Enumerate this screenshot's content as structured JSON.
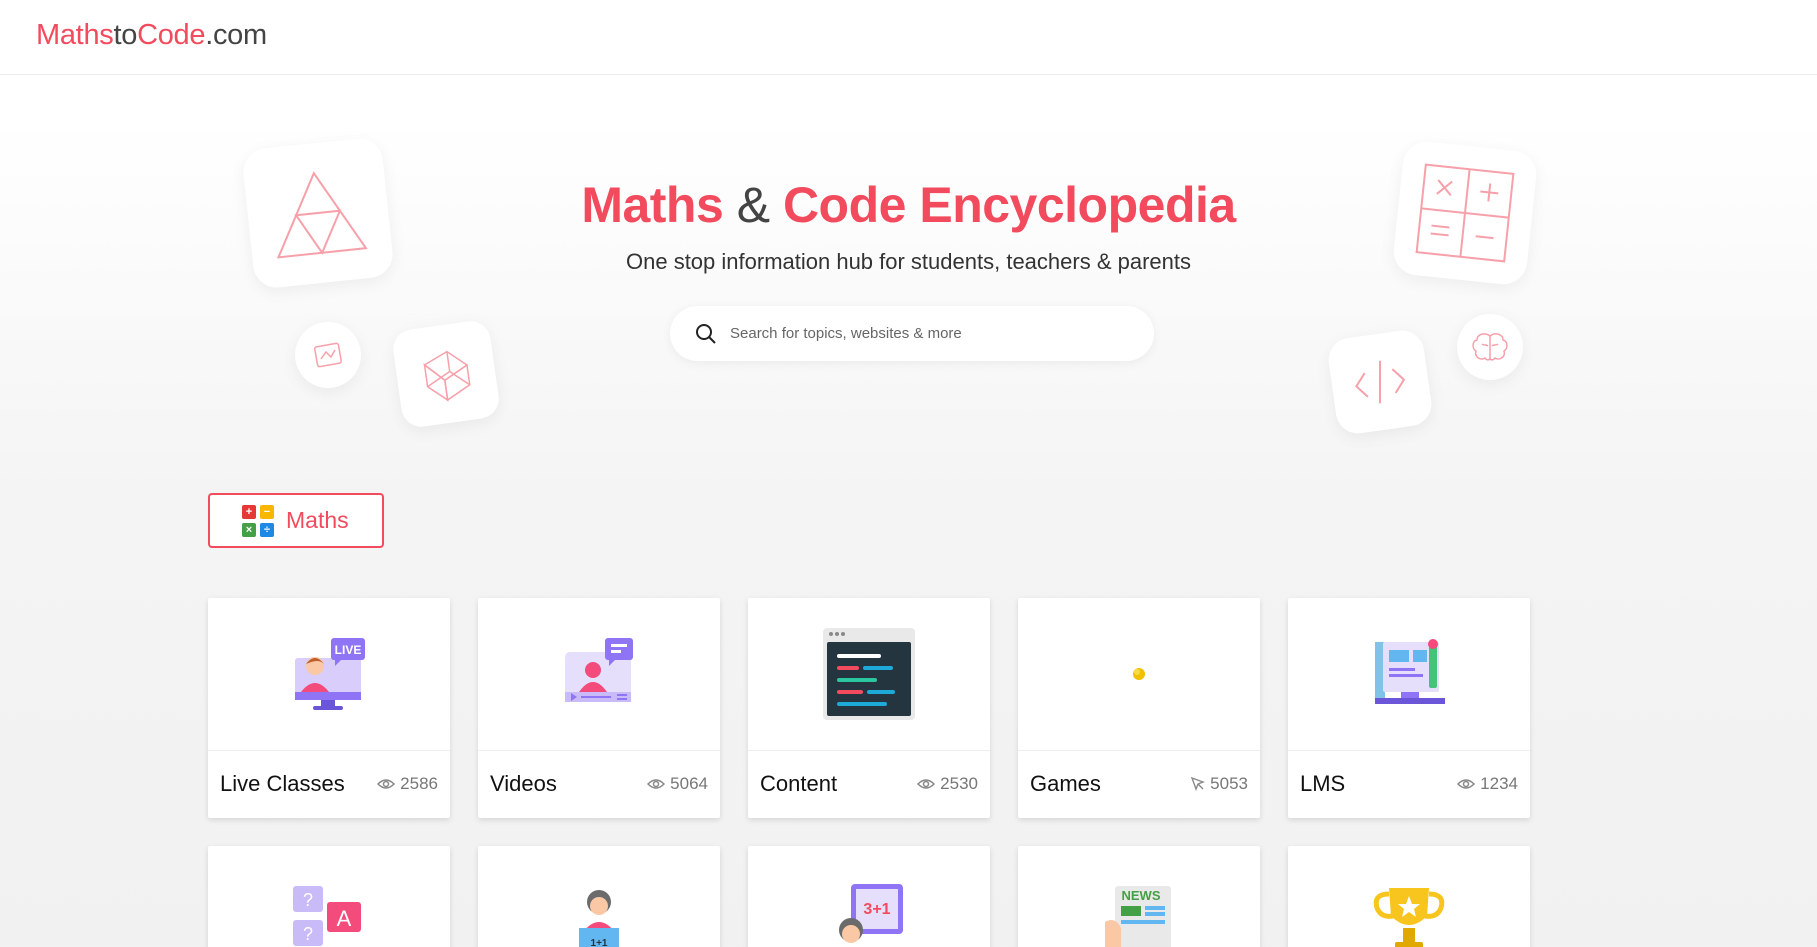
{
  "header": {
    "logo": {
      "part1": "Maths",
      "part2": "to",
      "part3": "Code",
      "part4": ".com"
    }
  },
  "hero": {
    "title_part1": "Maths",
    "title_amp": "&",
    "title_part2": "Code Encyclopedia",
    "subtitle": "One stop information hub for students, teachers & parents",
    "search_placeholder": "Search for topics, websites & more"
  },
  "category": {
    "label": "Maths",
    "icon_symbols": [
      "+",
      "−",
      "×",
      "÷"
    ]
  },
  "cards": [
    {
      "title": "Live Classes",
      "stat": "2586",
      "stat_icon": "eye-icon",
      "icon": "live-class-icon"
    },
    {
      "title": "Videos",
      "stat": "5064",
      "stat_icon": "eye-icon",
      "icon": "video-icon"
    },
    {
      "title": "Content",
      "stat": "2530",
      "stat_icon": "eye-icon",
      "icon": "code-screen-icon"
    },
    {
      "title": "Games",
      "stat": "5053",
      "stat_icon": "cursor-icon",
      "icon": "dot-icon"
    },
    {
      "title": "LMS",
      "stat": "1234",
      "stat_icon": "eye-icon",
      "icon": "lms-monitor-icon"
    }
  ],
  "cards_row2_icons": [
    "quiz-icon",
    "teacher-reading-icon",
    "math-teacher-icon",
    "news-icon",
    "trophy-icon"
  ],
  "row2_texts": {
    "live_badge": "LIVE",
    "math_board": "3+1",
    "news": "NEWS"
  },
  "colors": {
    "accent": "#f24b5e",
    "text": "#222222",
    "muted": "#777777"
  }
}
